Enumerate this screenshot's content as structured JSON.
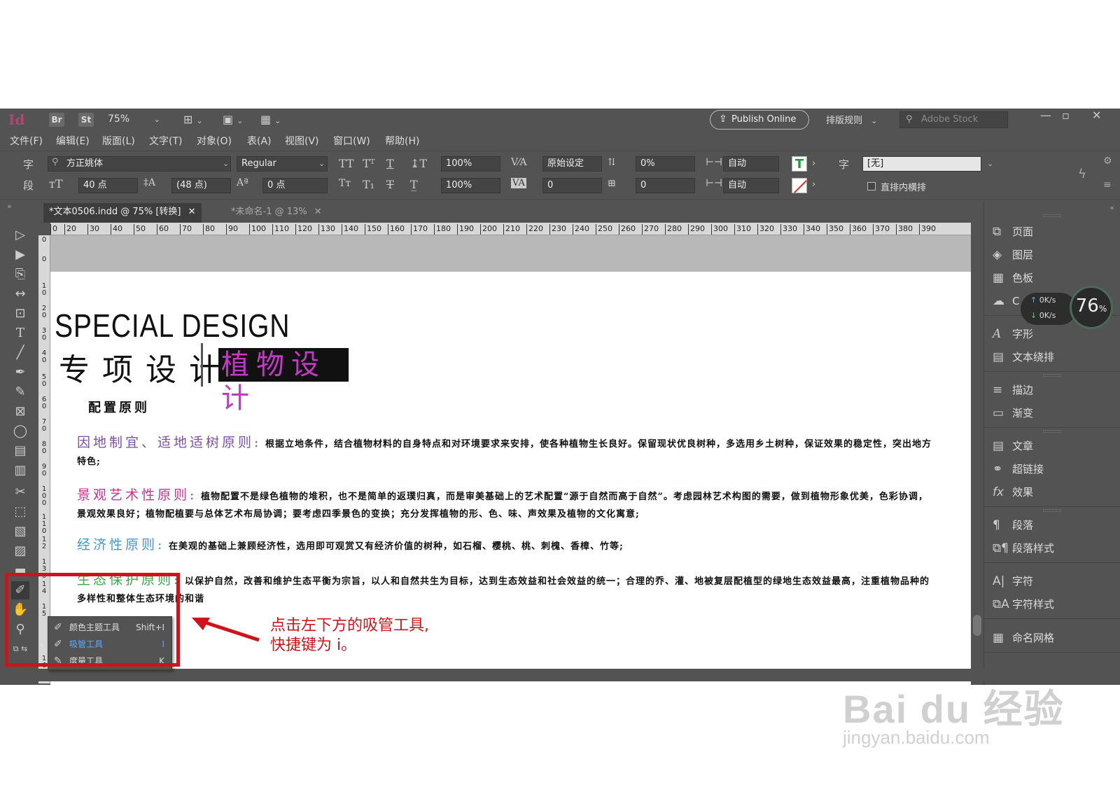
{
  "app": {
    "logo": "Id",
    "bridge_btn": "Br",
    "stock_btn": "St",
    "zoom": "75%",
    "publish_label": "Publish Online",
    "layout_rule": "排版规则",
    "stock_search_placeholder": "Adobe Stock"
  },
  "menu": [
    "文件(F)",
    "编辑(E)",
    "版面(L)",
    "文字(T)",
    "对象(O)",
    "表(A)",
    "视图(V)",
    "窗口(W)",
    "帮助(H)"
  ],
  "control": {
    "char_tab": "字",
    "para_tab": "段",
    "font_family": "方正姚体",
    "font_style": "Regular",
    "font_size": "40 点",
    "leading": "(48 点)",
    "kerning_method": "原始设定",
    "tracking": "0",
    "h_scale": "100%",
    "v_scale": "100%",
    "tsume": "0%",
    "aki_before": "0",
    "baseline": "0 点",
    "auto1": "自动",
    "auto2": "自动",
    "zi_label": "字",
    "char_style": "[无]",
    "tate_label": "直排内横排",
    "kerning_value": "0"
  },
  "tabs": [
    "*文本0506.indd @ 75% [转换]",
    "*未命名-1 @ 13%"
  ],
  "ruler_h": [
    "0",
    "20",
    "30",
    "40",
    "50",
    "60",
    "70",
    "80",
    "90",
    "100",
    "110",
    "120",
    "130",
    "140",
    "150",
    "160",
    "170",
    "180",
    "190",
    "200",
    "210",
    "220",
    "230",
    "240",
    "250",
    "260",
    "270",
    "280",
    "290",
    "300",
    "310",
    "320",
    "330",
    "340",
    "350",
    "360",
    "370",
    "380",
    "390"
  ],
  "ruler_v": [
    "0",
    "0",
    "1 0",
    "2 0",
    "3 0",
    "4 0",
    "5 0",
    "6 0",
    "7 0",
    "8 0",
    "9 0",
    "1 0 0",
    "1 1 0",
    "1 2",
    "1 3 0",
    "1 4",
    "1 5",
    "1 6"
  ],
  "panels": {
    "pages": "页面",
    "layers": "图层",
    "swatches": "色板",
    "cc_lib": "C",
    "glyphs": "字形",
    "text_wrap": "文本绕排",
    "stroke": "描边",
    "gradient": "渐变",
    "article": "文章",
    "hyperlinks": "超链接",
    "effects": "效果",
    "paragraph": "段落",
    "para_style": "段落样式",
    "character": "字符",
    "char_style": "字符样式",
    "named_grid": "命名网格"
  },
  "speed": {
    "up": "0K/s",
    "down": "0K/s",
    "pct": "76",
    "unit": "%"
  },
  "tool_popup": [
    {
      "name": "颜色主题工具",
      "key": "Shift+I"
    },
    {
      "name": "吸管工具",
      "key": "I"
    },
    {
      "name": "度量工具",
      "key": "K"
    }
  ],
  "annotation": {
    "line1": "点击左下方的吸管工具,",
    "line2": "快捷键为 i。"
  },
  "document": {
    "title_en": "SPECIAL DESIGN",
    "title_cn": "专项设计",
    "highlight": "植物设计",
    "section": "配置原则",
    "paragraphs": [
      {
        "head": "因地制宜、适地适树原则:",
        "color": "#7b4fa6",
        "body": "根据立地条件，结合植物材料的自身特点和对环境要求来安排，使各种植物生长良好。保留现状优良树种，多选用乡土树种，保证效果的稳定性，突出地方特色;"
      },
      {
        "head": "景观艺术性原则:",
        "color": "#d12f8a",
        "body": "植物配置不是绿色植物的堆积，也不是简单的返璞归真，而是审美基础上的艺术配置“源于自然而高于自然”。考虑园林艺术构图的需要，做到植物形象优美，色彩协调，景观效果良好；植物配植要与总体艺术布局协调；要考虑四季景色的变换；充分发挥植物的形、色、味、声效果及植物的文化寓意;"
      },
      {
        "head": "经济性原则:",
        "color": "#3a9ad4",
        "body": "在美观的基础上兼顾经济性，选用即可观赏又有经济价值的树种，如石榴、樱桃、桃、刺槐、香樟、竹等;"
      },
      {
        "head": "生态保护原则:",
        "color": "#3aa84a",
        "body": "以保护自然，改善和维护生态平衡为宗旨，以人和自然共生为目标，达到生态效益和社会效益的统一；合理的乔、灌、地被复层配植型的绿地生态效益最高，注重植物品种的多样性和整体生态环境的和谐"
      }
    ]
  },
  "watermark": {
    "brand": "Bai du 经验",
    "url": "jingyan.baidu.com"
  }
}
